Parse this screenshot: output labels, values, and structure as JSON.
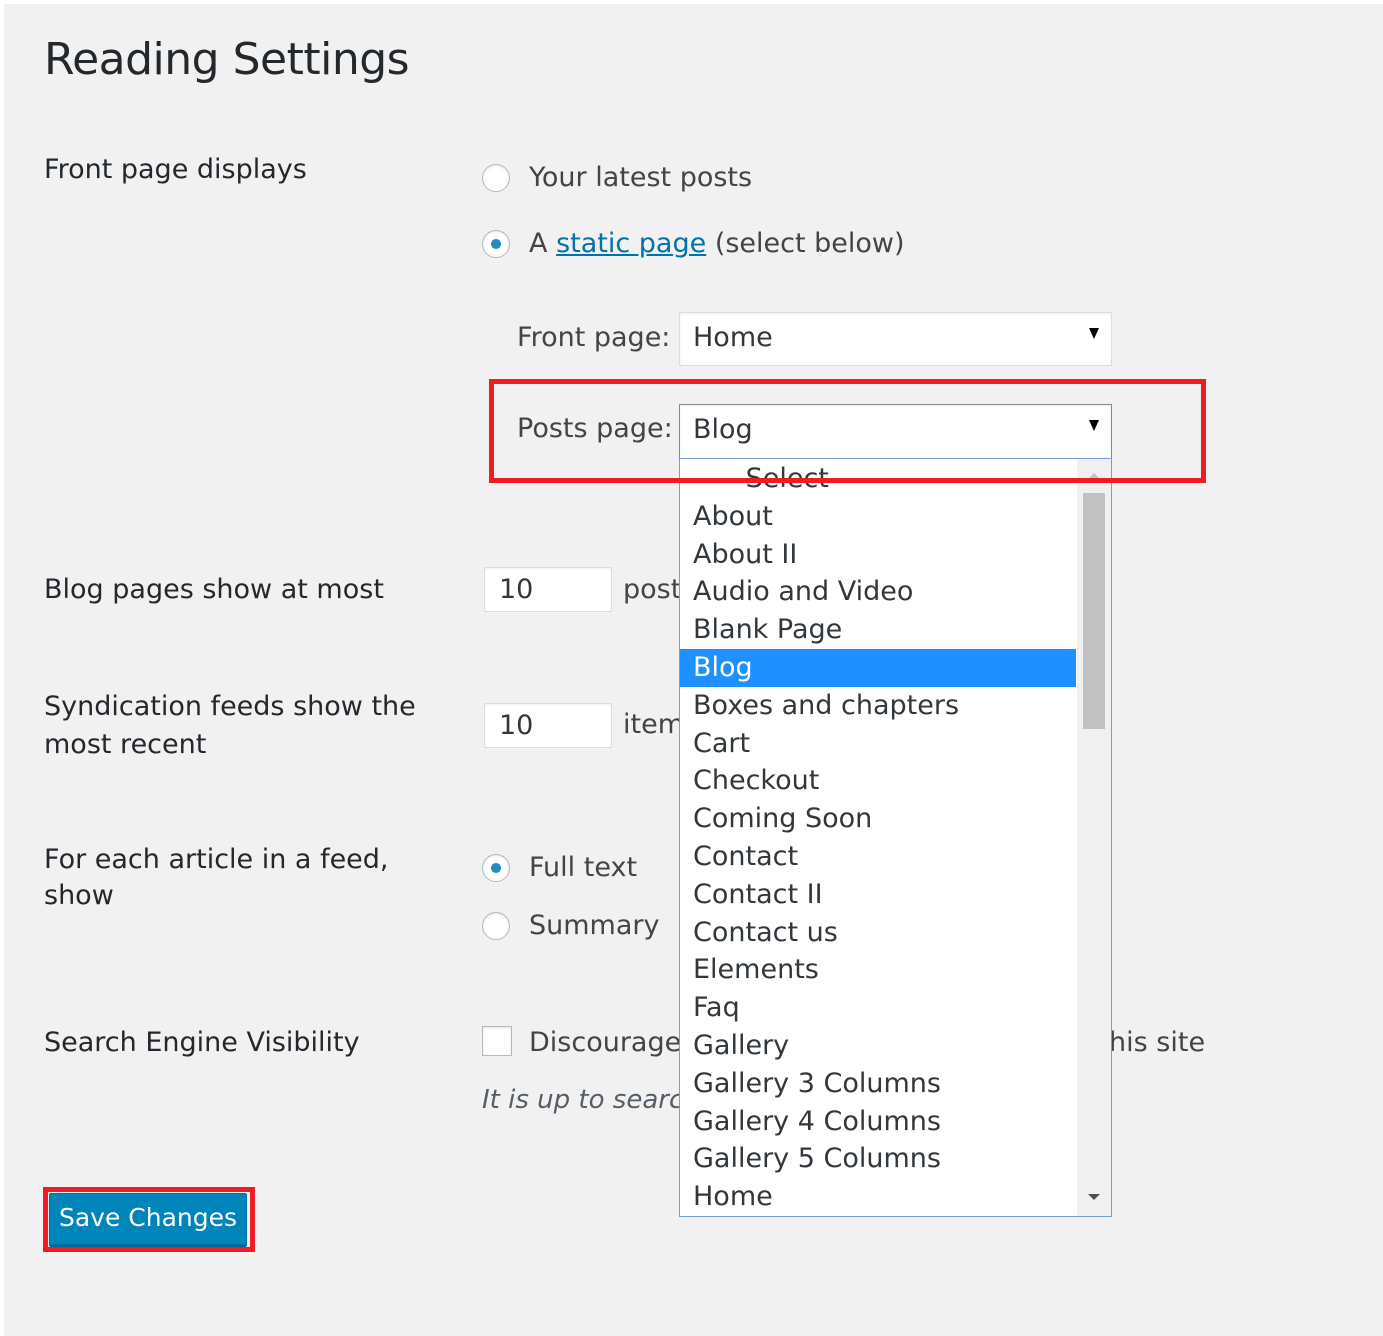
{
  "page": {
    "title": "Reading Settings"
  },
  "front_page_displays": {
    "label": "Front page displays",
    "option_latest": "Your latest posts",
    "option_static_prefix": "A",
    "option_static_link": "static page",
    "option_static_suffix": "(select below)",
    "selected": "static"
  },
  "front_page": {
    "label": "Front page:",
    "value": "Home"
  },
  "posts_page": {
    "label": "Posts page:",
    "value": "Blog"
  },
  "dropdown": {
    "items": [
      "— Select —",
      "About",
      "About II",
      "Audio and Video",
      "Blank Page",
      "Blog",
      "Boxes and chapters",
      "Cart",
      "Checkout",
      "Coming Soon",
      "Contact",
      "Contact II",
      "Contact us",
      "Elements",
      "Faq",
      "Gallery",
      "Gallery 3 Columns",
      "Gallery 4 Columns",
      "Gallery 5 Columns",
      "Home"
    ],
    "selected": "Blog"
  },
  "blog_pages": {
    "label": "Blog pages show at most",
    "value": "10",
    "suffix": "posts"
  },
  "syndication": {
    "label_line1": "Syndication feeds show the",
    "label_line2": "most recent",
    "value": "10",
    "suffix": "items"
  },
  "feed_article": {
    "label_line1": "For each article in a feed,",
    "label_line2": "show",
    "option_full": "Full text",
    "option_summary": "Summary",
    "selected": "full"
  },
  "search_visibility": {
    "label": "Search Engine Visibility",
    "checkbox_text": "Discourage search engines from indexing this site",
    "description": "It is up to search engines to honor this request."
  },
  "save_button": {
    "label": "Save Changes"
  },
  "colors": {
    "accent": "#0085ba",
    "selected_item": "#1e90ff",
    "highlight": "#ee1c25",
    "link": "#0073aa"
  }
}
